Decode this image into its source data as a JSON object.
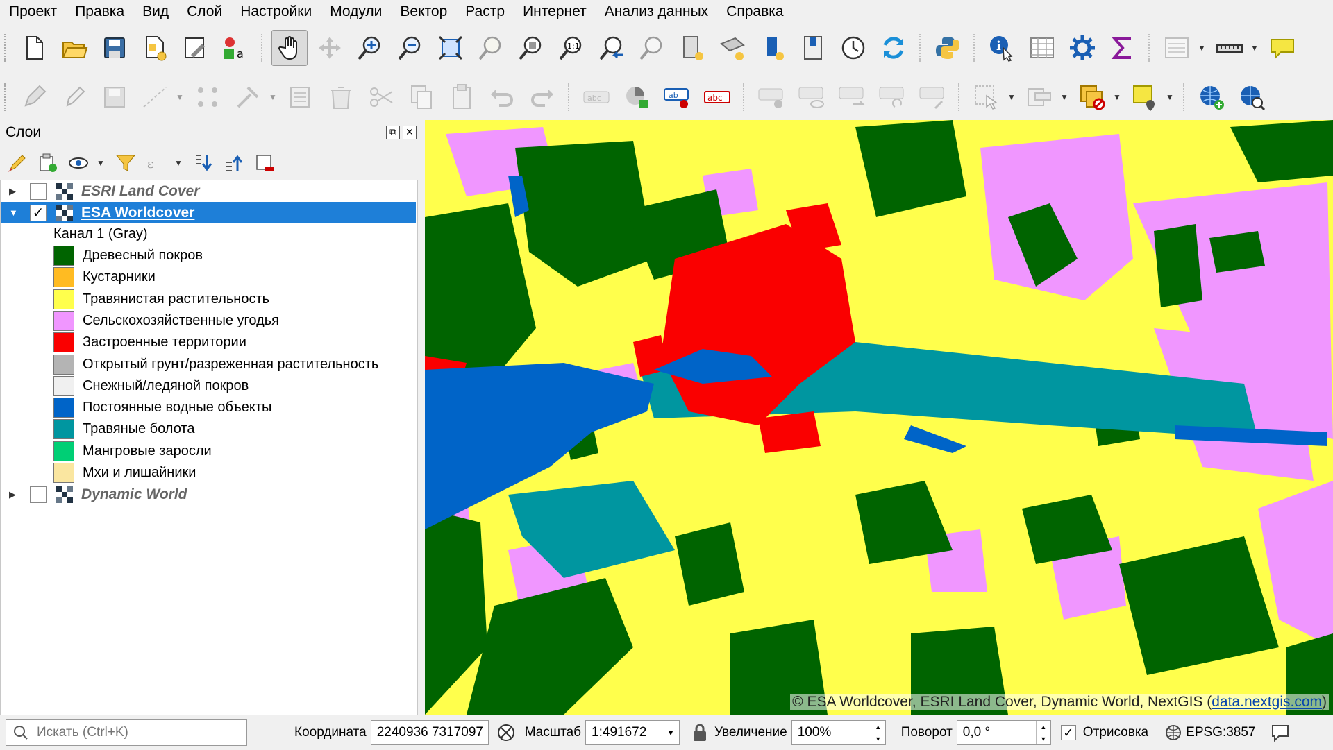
{
  "menu": [
    "Проект",
    "Правка",
    "Вид",
    "Слой",
    "Настройки",
    "Модули",
    "Вектор",
    "Растр",
    "Интернет",
    "Анализ данных",
    "Справка"
  ],
  "toolbar": {
    "row1_icons": [
      "new-project-icon",
      "open-project-icon",
      "save-project-icon",
      "print-layout-icon",
      "layout-manager-icon",
      "style-manager-icon",
      "pan-icon",
      "pan-to-selection-icon",
      "zoom-in-icon",
      "zoom-out-icon",
      "zoom-full-icon",
      "zoom-selection-icon",
      "zoom-layer-icon",
      "zoom-native-icon",
      "zoom-last-icon",
      "zoom-next-icon",
      "new-bookmark-icon",
      "show-bookmarks-icon",
      "temporal-controller-icon",
      "refresh-icon",
      "python-console-icon",
      "identify-icon",
      "attribute-table-icon",
      "processing-toolbox-icon",
      "statistics-icon",
      "measure-icon",
      "annotation-icon"
    ],
    "row2_icons": [
      "current-edits-icon",
      "toggle-editing-icon",
      "save-edits-icon",
      "digitize-icon",
      "vertex-tool-icon",
      "modify-attributes-icon",
      "delete-selected-icon",
      "cut-features-icon",
      "copy-features-icon",
      "paste-features-icon",
      "undo-icon",
      "redo-icon",
      "label-tool-icon",
      "diagram-tool-icon",
      "label-pin-icon",
      "label-highlight-icon",
      "show-hide-labels-icon",
      "move-label-icon",
      "rotate-label-icon",
      "change-label-icon",
      "select-features-icon",
      "select-by-value-icon",
      "deselect-icon",
      "select-location-icon",
      "add-wms-icon",
      "search-wms-icon"
    ]
  },
  "layers_panel": {
    "title": "Слои",
    "layers": [
      {
        "name": "ESRI Land Cover",
        "checked": false,
        "expanded": false,
        "selected": false
      },
      {
        "name": "ESA Worldcover",
        "checked": true,
        "expanded": true,
        "selected": true
      },
      {
        "name": "Dynamic World",
        "checked": false,
        "expanded": false,
        "selected": false
      }
    ],
    "band": "Канал 1 (Gray)",
    "legend": [
      {
        "label": "Древесный покров",
        "color": "#006400"
      },
      {
        "label": "Кустарники",
        "color": "#ffbb22"
      },
      {
        "label": "Травянистая растительность",
        "color": "#ffff4c"
      },
      {
        "label": "Сельскохозяйственные угодья",
        "color": "#f096ff"
      },
      {
        "label": "Застроенные территории",
        "color": "#fa0000"
      },
      {
        "label": "Открытый грунт/разреженная растительность",
        "color": "#b4b4b4"
      },
      {
        "label": "Снежный/ледяной покров",
        "color": "#f0f0f0"
      },
      {
        "label": "Постоянные водные объекты",
        "color": "#0064c8"
      },
      {
        "label": "Травяные болота",
        "color": "#0096a0"
      },
      {
        "label": "Мангровые заросли",
        "color": "#00cf75"
      },
      {
        "label": "Мхи и лишайники",
        "color": "#fae6a0"
      }
    ]
  },
  "map": {
    "attribution": "© ESA Worldcover, ESRI Land Cover, Dynamic World, NextGIS (",
    "attribution_link": "data.nextgis.com",
    "attribution_end": ")"
  },
  "status": {
    "search_placeholder": "Искать (Ctrl+K)",
    "coord_label": "Координата",
    "coord_value": "2240936  7317097",
    "scale_label": "Масштаб",
    "scale_value": "1:491672",
    "magnifier_label": "Увеличение",
    "magnifier_value": "100%",
    "rotation_label": "Поворот",
    "rotation_value": "0,0 °",
    "render_label": "Отрисовка",
    "render_checked": true,
    "crs": "EPSG:3857"
  }
}
